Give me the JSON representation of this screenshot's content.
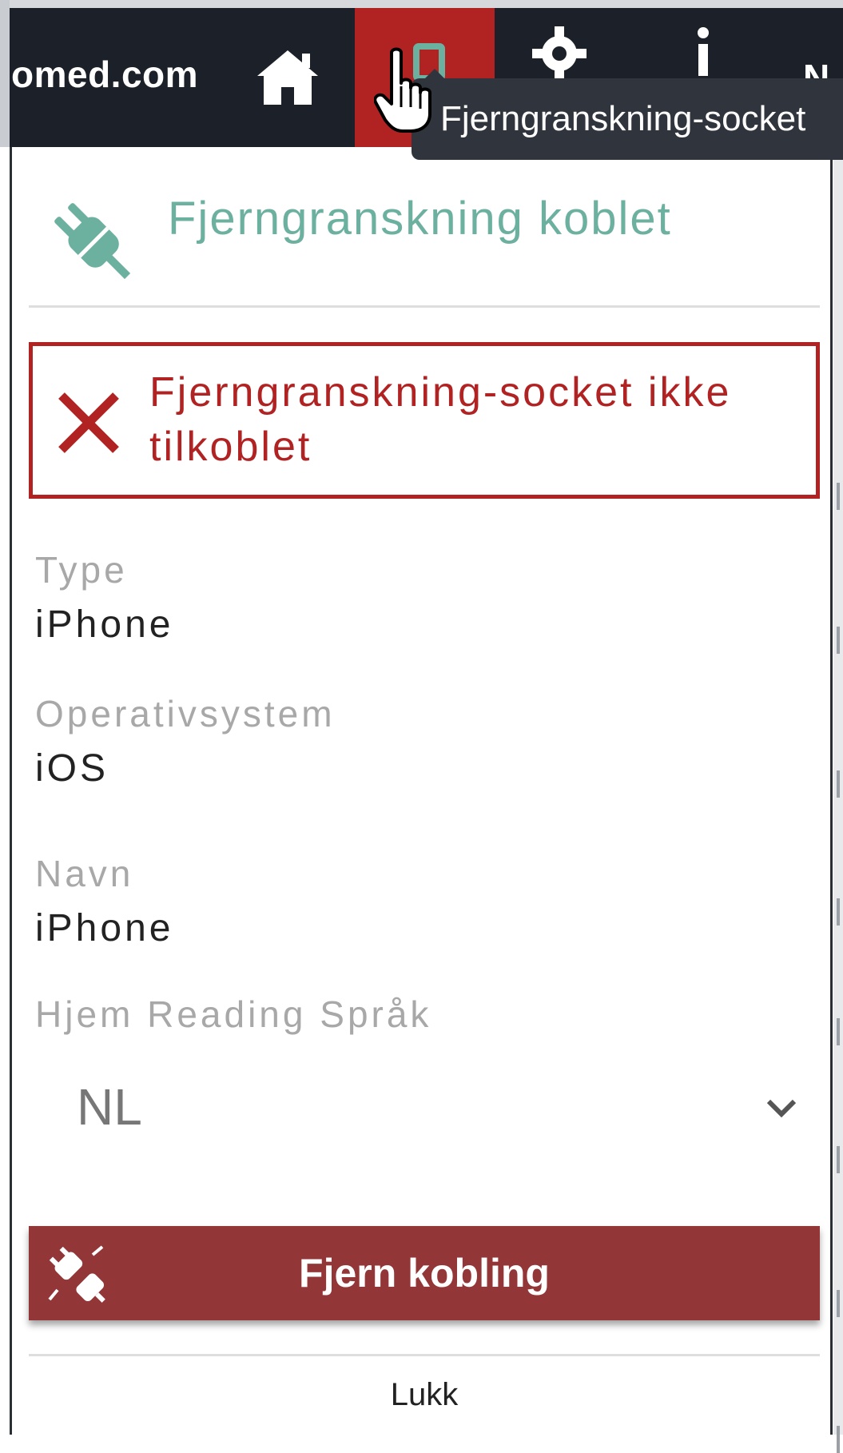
{
  "header": {
    "domain": "omed.com",
    "nav": {
      "home_icon": "home-icon",
      "remote_icon": "remote-socket-icon",
      "settings_icon": "gear-icon",
      "info_icon": "info-icon",
      "cut_label": "N"
    },
    "active_color": "#b12323"
  },
  "tooltip": {
    "text": "Fjerngranskning-socket"
  },
  "panel": {
    "connection_title": "Fjerngranskning koblet",
    "connection_icon": "plug-icon",
    "error_text": "Fjerngranskning-socket ikke tilkoblet",
    "error_icon": "close-icon",
    "fields": {
      "type_label": "Type",
      "type_value": "iPhone",
      "os_label": "Operativsystem",
      "os_value": "iOS",
      "name_label": "Navn",
      "name_value": "iPhone",
      "language_label": "Hjem Reading Språk"
    },
    "language_select": {
      "value": "NL"
    },
    "disconnect_button": "Fjern kobling",
    "disconnect_icon": "unplug-icon",
    "close_link": "Lukk"
  },
  "colors": {
    "accent_teal": "#6cb09f",
    "error_red": "#b12323",
    "button_red": "#923637",
    "topbar": "#1c2028"
  }
}
